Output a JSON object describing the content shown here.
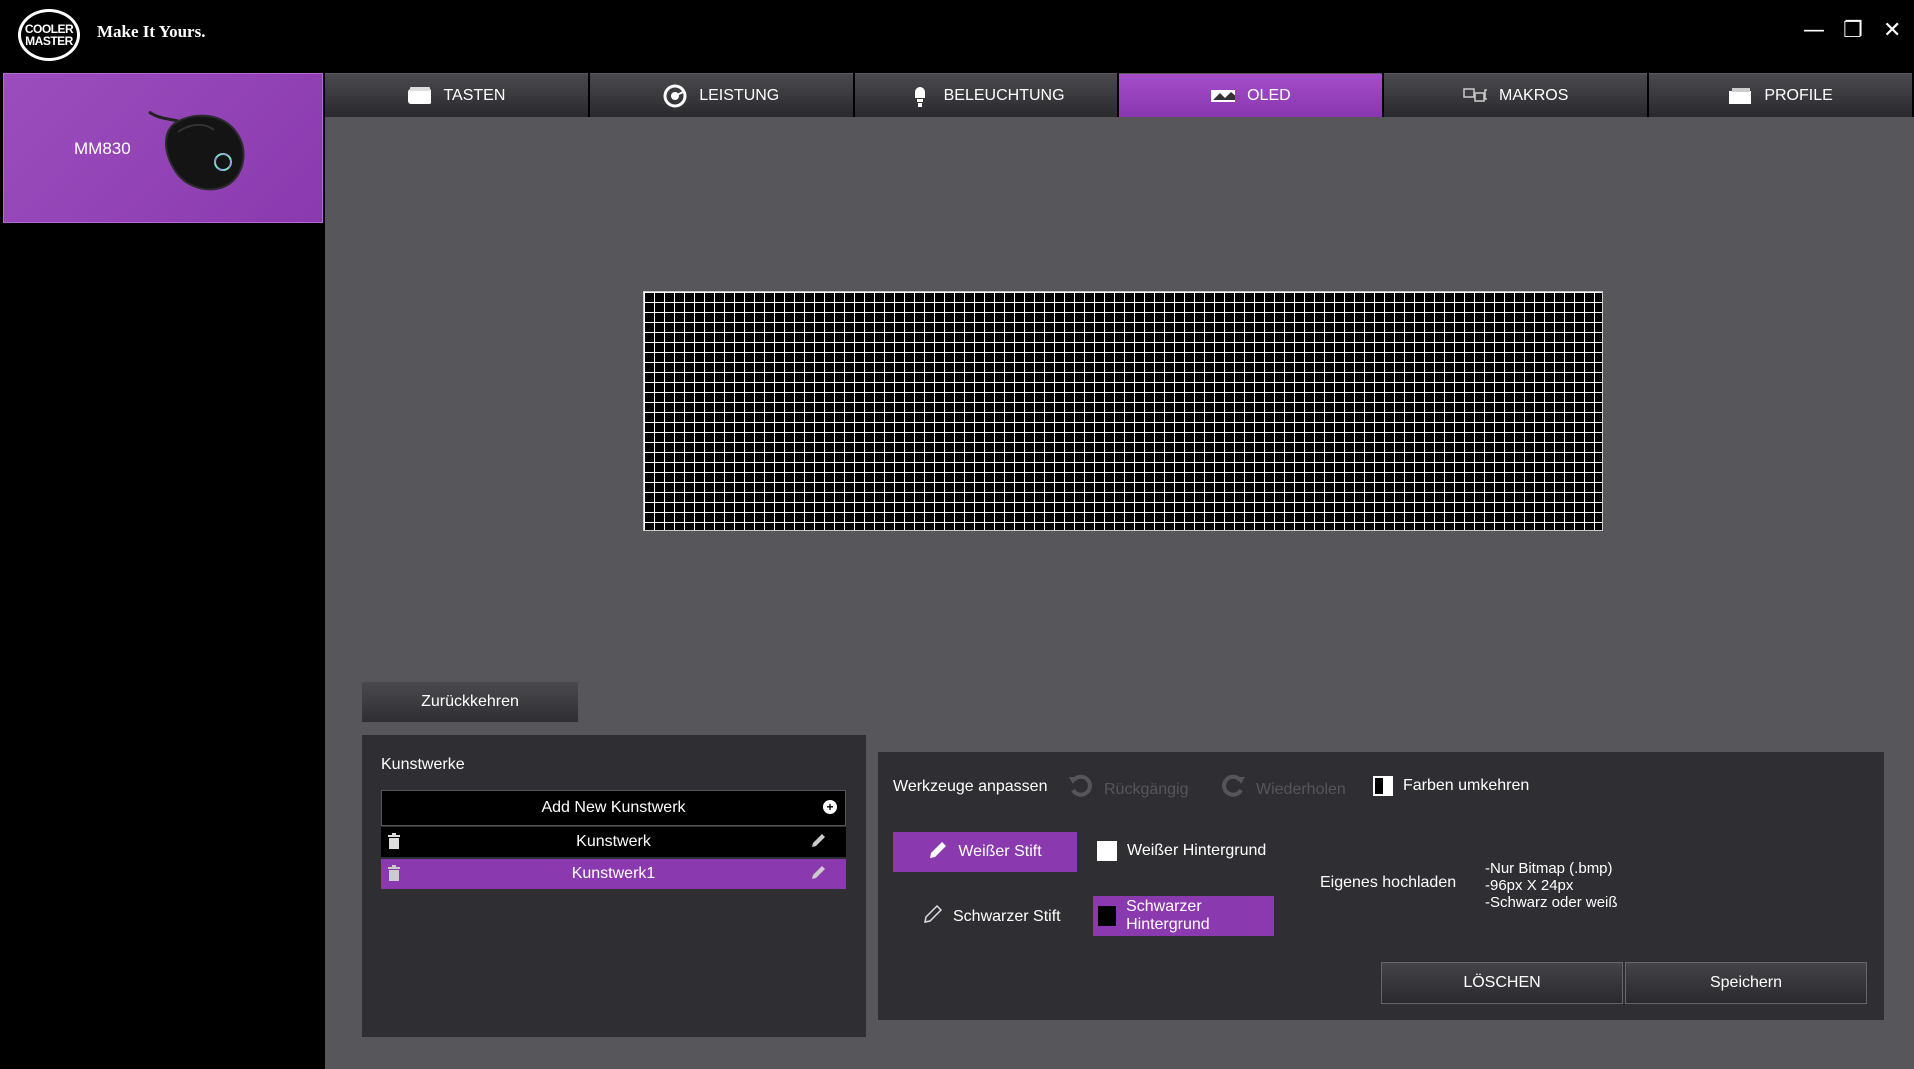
{
  "app": {
    "logo_lines": [
      "COOLER",
      "MASTER"
    ],
    "tagline": "Make It Yours.",
    "window_controls": {
      "minimize": "—",
      "maximize": "❐",
      "close": "✕"
    }
  },
  "device": {
    "name": "MM830"
  },
  "tabs": [
    {
      "label": "TASTEN",
      "icon": "keyboard-icon",
      "active": false
    },
    {
      "label": "LEISTUNG",
      "icon": "speedometer-icon",
      "active": false
    },
    {
      "label": "BELEUCHTUNG",
      "icon": "bulb-icon",
      "active": false
    },
    {
      "label": "OLED",
      "icon": "oled-display-icon",
      "active": true
    },
    {
      "label": "MAKROS",
      "icon": "macro-icon",
      "active": false
    },
    {
      "label": "PROFILE",
      "icon": "profile-icon",
      "active": false
    }
  ],
  "oled_grid": {
    "columns": 96,
    "rows": 24
  },
  "back_button": "Zurückkehren",
  "artworks": {
    "title": "Kunstwerke",
    "add_label": "Add New Kunstwerk",
    "items": [
      {
        "name": "Kunstwerk",
        "selected": false
      },
      {
        "name": "Kunstwerk1",
        "selected": true
      }
    ]
  },
  "tools": {
    "title": "Werkzeuge anpassen",
    "undo": "Rückgängig",
    "redo": "Wiederholen",
    "invert": "Farben umkehren",
    "white_pen": "Weißer Stift",
    "black_pen": "Schwarzer Stift",
    "white_bg": "Weißer Hintergrund",
    "black_bg": "Schwarzer Hintergrund",
    "upload": "Eigenes hochladen",
    "requirements": [
      "-Nur Bitmap (.bmp)",
      "-96px X 24px",
      "-Schwarz oder weiß"
    ],
    "delete": "LÖSCHEN",
    "save": "Speichern"
  },
  "colors": {
    "accent": "#8a3aae",
    "panel": "#2f2f33",
    "workspace": "#56565b"
  }
}
